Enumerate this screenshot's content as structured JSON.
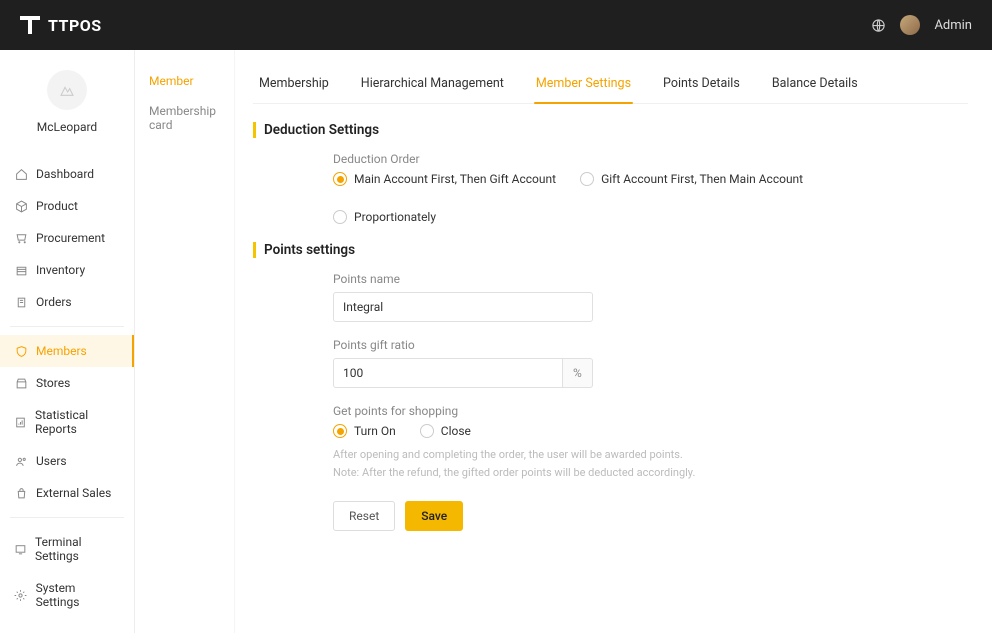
{
  "brand": "TTPOS",
  "top": {
    "admin_label": "Admin"
  },
  "org": {
    "name": "McLeopard"
  },
  "sidebar": {
    "items": [
      {
        "label": "Dashboard"
      },
      {
        "label": "Product"
      },
      {
        "label": "Procurement"
      },
      {
        "label": "Inventory"
      },
      {
        "label": "Orders"
      },
      {
        "label": "Members"
      },
      {
        "label": "Stores"
      },
      {
        "label": "Statistical Reports"
      },
      {
        "label": "Users"
      },
      {
        "label": "External Sales"
      },
      {
        "label": "Terminal Settings"
      },
      {
        "label": "System Settings"
      }
    ]
  },
  "subnav": {
    "items": [
      {
        "label": "Member"
      },
      {
        "label": "Membership card"
      }
    ]
  },
  "tabs": [
    {
      "label": "Membership"
    },
    {
      "label": "Hierarchical Management"
    },
    {
      "label": "Member Settings"
    },
    {
      "label": "Points Details"
    },
    {
      "label": "Balance Details"
    }
  ],
  "sections": {
    "deduction": {
      "title": "Deduction Settings",
      "order_label": "Deduction Order",
      "options": [
        "Main Account First, Then Gift Account",
        "Gift Account First, Then Main Account",
        "Proportionately"
      ]
    },
    "points": {
      "title": "Points settings",
      "name_label": "Points name",
      "name_value": "Integral",
      "ratio_label": "Points gift ratio",
      "ratio_value": "100",
      "ratio_suffix": "%",
      "shopping_label": "Get points for shopping",
      "shopping_options": [
        "Turn On",
        "Close"
      ],
      "help1": "After opening and completing the order, the user will be awarded points.",
      "help2": "Note: After the refund, the gifted order points will be deducted accordingly."
    }
  },
  "buttons": {
    "reset": "Reset",
    "save": "Save"
  }
}
